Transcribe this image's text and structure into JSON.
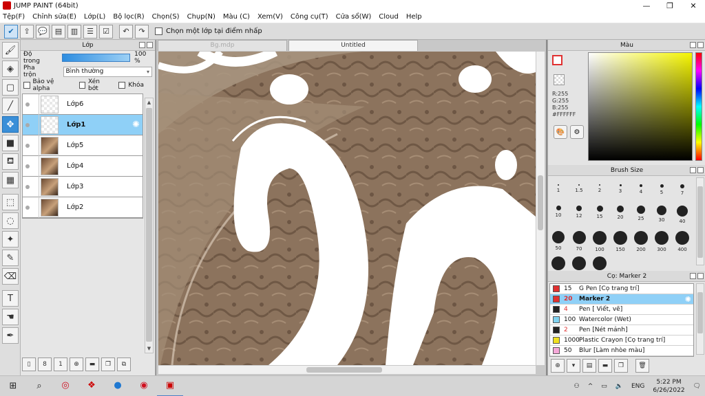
{
  "window": {
    "title": "JUMP PAINT (64bit)",
    "minimize": "—",
    "restore": "❐",
    "close": "✕"
  },
  "menu": [
    "Tệp(F)",
    "Chỉnh sửa(E)",
    "Lớp(L)",
    "Bộ lọc(R)",
    "Chọn(S)",
    "Chụp(N)",
    "Màu (C)",
    "Xem(V)",
    "Công cụ(T)",
    "Cửa sổ(W)",
    "Cloud",
    "Help"
  ],
  "toolbar": {
    "checkbox_label": "Chọn một lớp tại điểm nhấp"
  },
  "layer_panel": {
    "title": "Lớp",
    "opacity_label": "Độ trong",
    "opacity_value": "100 %",
    "opacity_fraction": 1.0,
    "blend_label": "Pha trộn",
    "blend_value": "Bình thường",
    "protect_alpha": "Bảo vệ alpha",
    "clip": "Xén bớt",
    "lock": "Khóa",
    "layers": [
      {
        "name": "Lớp6",
        "thumb": "empty",
        "selected": false
      },
      {
        "name": "Lớp1",
        "thumb": "empty",
        "selected": true
      },
      {
        "name": "Lớp5",
        "thumb": "photo",
        "selected": false
      },
      {
        "name": "Lớp4",
        "thumb": "photo",
        "selected": false
      },
      {
        "name": "Lớp3",
        "thumb": "photo",
        "selected": false
      },
      {
        "name": "Lớp2",
        "thumb": "photo",
        "selected": false
      }
    ]
  },
  "canvas": {
    "tabs": [
      {
        "label": "Bg.mdp",
        "active": false
      },
      {
        "label": "Untitled",
        "active": true
      }
    ]
  },
  "color_panel": {
    "title": "Màu",
    "r": "R:255",
    "g": "G:255",
    "b": "B:255",
    "hex": "#FFFFFF",
    "accent": "#e03030"
  },
  "brush_size_panel": {
    "title": "Brush Size",
    "sizes": [
      "1",
      "1.5",
      "2",
      "3",
      "4",
      "5",
      "7",
      "10",
      "12",
      "15",
      "20",
      "25",
      "30",
      "40",
      "50",
      "70",
      "100",
      "150",
      "200",
      "300",
      "400",
      "",
      "",
      ""
    ]
  },
  "preset_panel": {
    "title": "Cọ: Marker 2",
    "presets": [
      {
        "size": "15",
        "name": "G Pen [Cọ trang trí]",
        "color": "#e03030",
        "selected": false
      },
      {
        "size": "20",
        "name": "Marker 2",
        "color": "#e03030",
        "selected": true
      },
      {
        "size": "4",
        "name": "Pen [ Viết, vẽ]",
        "color": "#222222",
        "selected": false
      },
      {
        "size": "100",
        "name": "Watercolor (Wet)",
        "color": "#7fd2f0",
        "selected": false
      },
      {
        "size": "2",
        "name": "Pen [Nét mảnh]",
        "color": "#222222",
        "selected": false
      },
      {
        "size": "1000",
        "name": "Plastic Crayon [Cọ trang trí]",
        "color": "#f0e020",
        "selected": false
      },
      {
        "size": "50",
        "name": "Blur [Làm nhòe màu]",
        "color": "#f5a8d8",
        "selected": false
      }
    ]
  },
  "taskbar": {
    "lang": "ENG",
    "time": "5:22 PM",
    "date": "6/26/2022"
  }
}
